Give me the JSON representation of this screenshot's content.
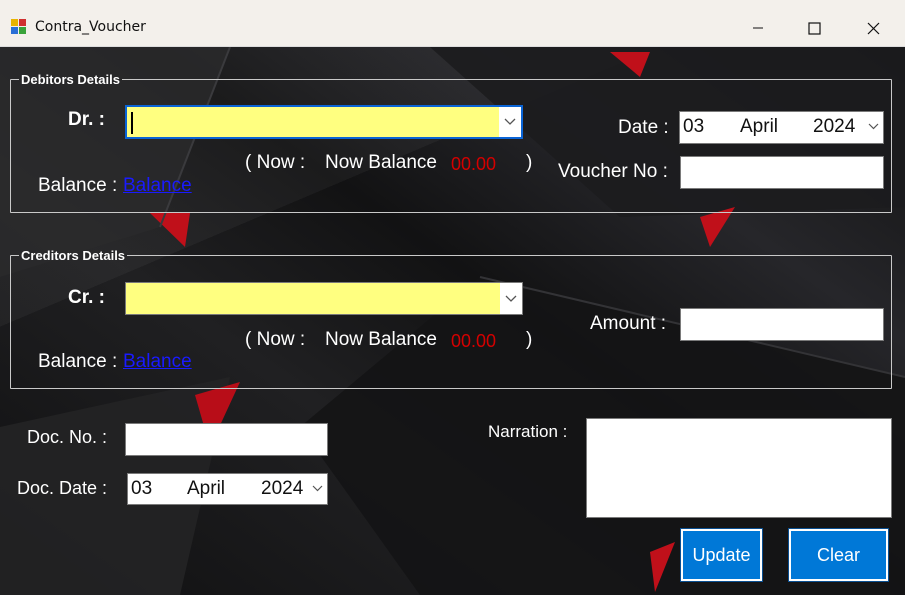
{
  "window": {
    "title": "Contra_Voucher"
  },
  "debitors": {
    "group_title": "Debitors Details",
    "dr_label": "Dr. :",
    "now_open": "(  Now :",
    "now_balance_label": "Now Balance",
    "now_balance_value": "00.00",
    "now_close": ")",
    "balance_label": "Balance :",
    "balance_link": "Balance",
    "date_label": "Date :",
    "date": {
      "day": "03",
      "month": "April",
      "year": "2024"
    },
    "voucher_label": "Voucher No :",
    "voucher_value": ""
  },
  "creditors": {
    "group_title": "Creditors Details",
    "cr_label": "Cr. :",
    "now_open": "(  Now :",
    "now_balance_label": "Now Balance",
    "now_balance_value": "00.00",
    "now_close": ")",
    "balance_label": "Balance :",
    "balance_link": "Balance",
    "amount_label": "Amount :",
    "amount_value": ""
  },
  "document": {
    "doc_no_label": "Doc. No. :",
    "doc_no_value": "",
    "doc_date_label": "Doc. Date :",
    "doc_date": {
      "day": "03",
      "month": "April",
      "year": "2024"
    },
    "narration_label": "Narration :",
    "narration_value": ""
  },
  "actions": {
    "update_label": "Update",
    "clear_label": "Clear"
  },
  "colors": {
    "accent": "#0078d7",
    "combo_bg": "#ffff80",
    "balance_value": "#d40000",
    "link": "#1a1aff"
  },
  "icons": [
    "app-icon",
    "minimize-icon",
    "maximize-icon",
    "close-icon",
    "chevron-down-icon"
  ]
}
